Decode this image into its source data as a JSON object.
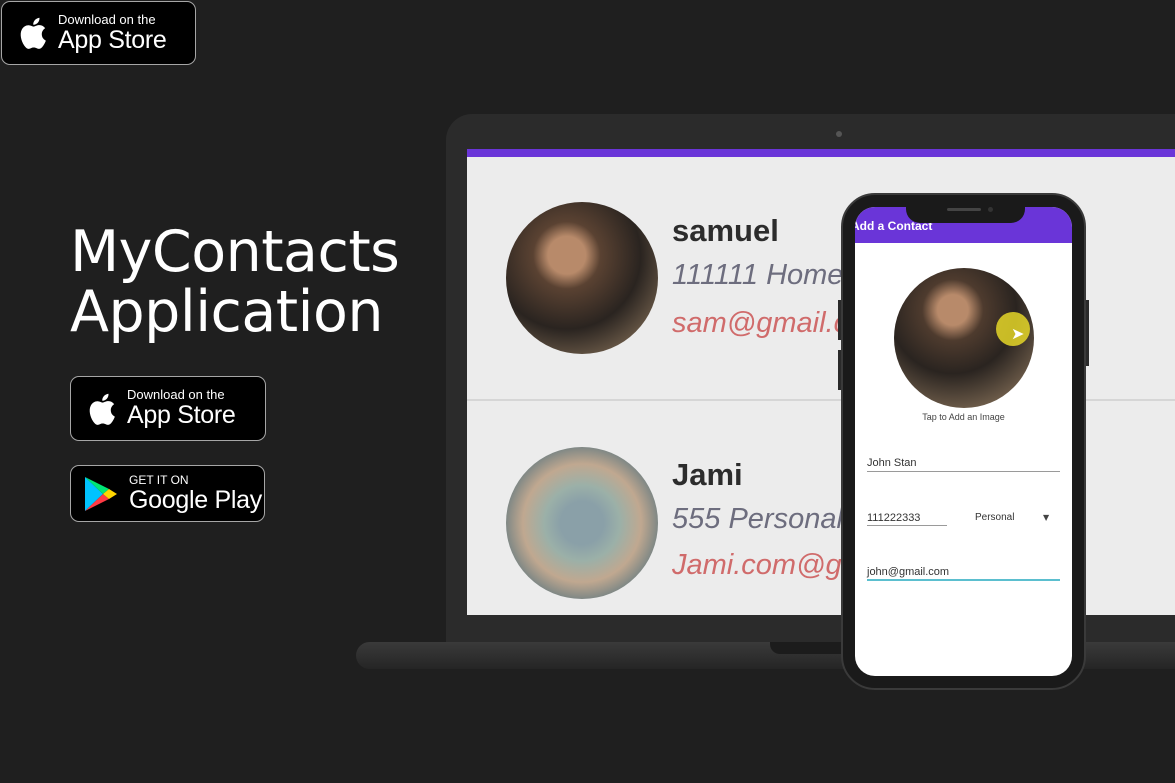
{
  "badges": {
    "top_appstore": {
      "small": "Download on the",
      "big": "App Store",
      "icon": "apple-icon"
    },
    "appstore": {
      "small": "Download on the",
      "big": "App Store",
      "icon": "apple-icon"
    },
    "googleplay": {
      "small": "GET IT ON",
      "big": "Google Play",
      "icon": "google-play-icon"
    }
  },
  "title": {
    "line1": "MyContacts",
    "line2": "Application"
  },
  "laptop_screen": {
    "contacts": [
      {
        "name": "samuel",
        "phone": "111111 Home",
        "email": "sam@gmail.com"
      },
      {
        "name": "Jami",
        "phone": "555 Personal",
        "email": "Jami.com@gmail.com"
      }
    ]
  },
  "phone": {
    "appbar_title": "Add a Contact",
    "tap_label": "Tap to Add an Image",
    "name_value": "John Stan",
    "phone_value": "111222333",
    "type_value": "Personal",
    "email_value": "john@gmail.com"
  },
  "colors": {
    "accent": "#6a35d8",
    "background": "#1f1f1f",
    "focus": "#5bbfcf"
  }
}
